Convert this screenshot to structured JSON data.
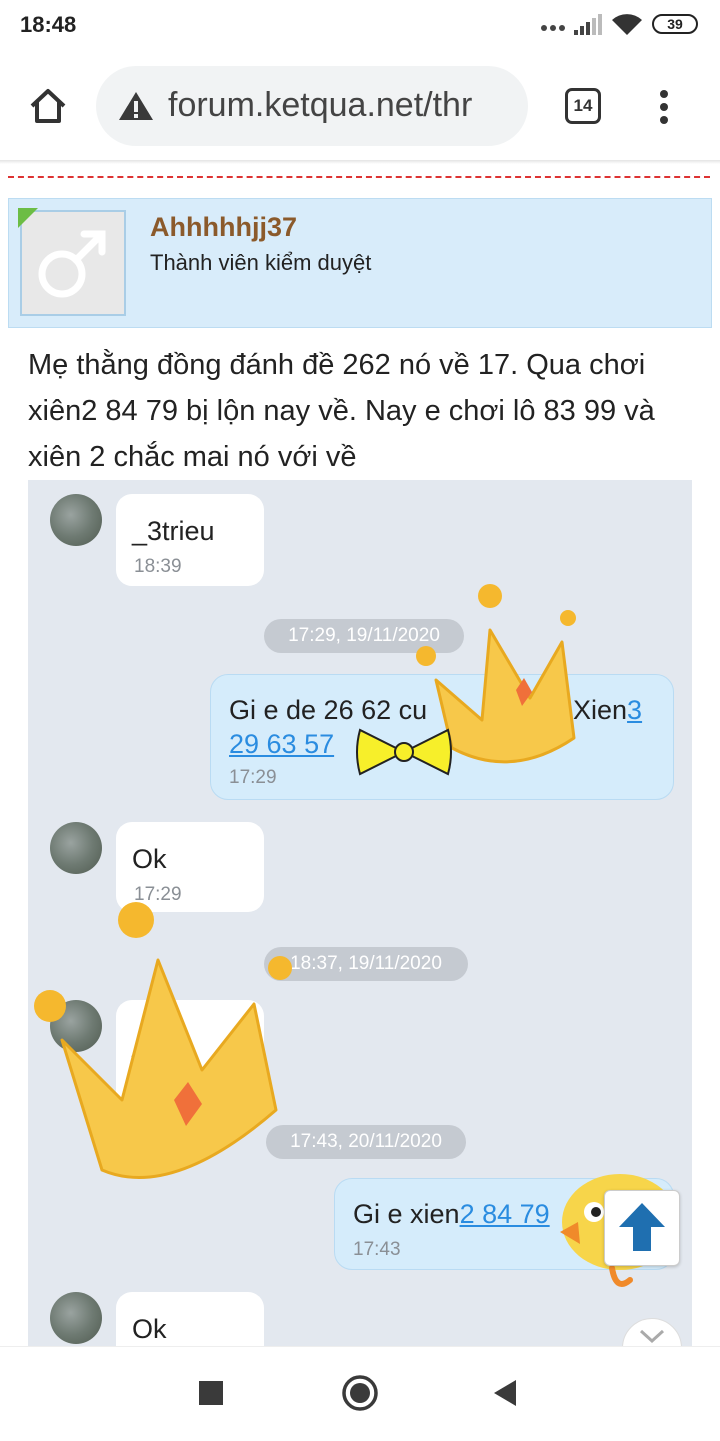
{
  "status_bar": {
    "time": "18:48",
    "battery": "39"
  },
  "browser": {
    "url": "forum.ketqua.net/thr",
    "tab_count": "14"
  },
  "post": {
    "username": "Ahhhhhjj37",
    "role": "Thành viên kiểm duyệt",
    "text": "Mẹ thằng đồng đánh đề 262 nó về 17. Qua chơi xiên2 84 79 bị lộn nay về. Nay e chơi lô 83 99 và xiên 2 chắc mai nó với về"
  },
  "chat": {
    "messages": [
      {
        "text": "_3trieu",
        "time": "18:39"
      },
      {
        "timestamp": "17:29, 19/11/2020"
      },
      {
        "text_prefix": "Gi e de 26 62 cu",
        "text_hidden_tail": "Xien",
        "link_1": "3",
        "link_2": "29 63 57",
        "time": "17:29"
      },
      {
        "text": "Ok",
        "time": "17:29"
      },
      {
        "timestamp": "18:37, 19/11/2020"
      },
      {
        "text": "_"
      },
      {
        "timestamp": "17:43, 20/11/2020"
      },
      {
        "text_prefix": "Gi e xien",
        "link": "2 84 79",
        "time": "17:43"
      },
      {
        "text": "Ok"
      }
    ]
  },
  "colors": {
    "username": "#8b5a2b",
    "user_card_bg": "#d8ecfa",
    "chat_bg": "#e3e8ef",
    "link": "#2a8ce0",
    "scroll_top_arrow": "#1f6fb0"
  },
  "icons": {
    "home": "home-icon",
    "warning": "not-secure-icon",
    "menu": "more-vert-icon",
    "scroll_top": "arrow-up-icon",
    "nav_recent": "square-icon",
    "nav_home": "circle-icon",
    "nav_back": "triangle-back-icon"
  }
}
